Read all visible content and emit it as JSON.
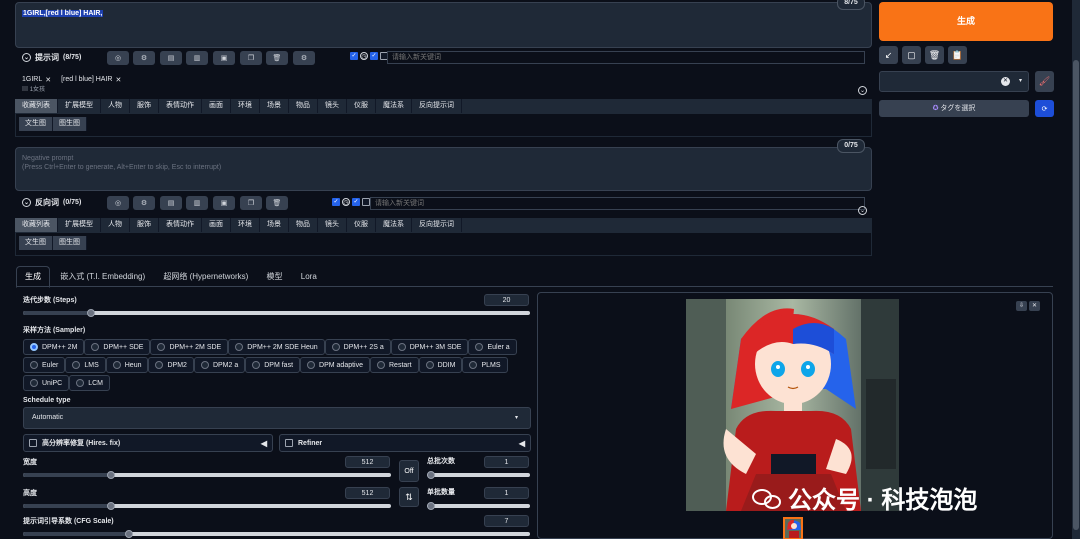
{
  "prompt": {
    "text": "1GIRL,[red l blue] HAIR,",
    "counter": "8/75",
    "label": "提示词",
    "label_count": "(8/75)",
    "search_placeholder": "请输入新关键词",
    "tags": [
      {
        "name": "1GIRL",
        "sub": "1女孩"
      },
      {
        "name": "[red l blue] HAIR",
        "sub": ""
      }
    ]
  },
  "negative": {
    "placeholder_line1": "Negative prompt",
    "placeholder_line2": "(Press Ctrl+Enter to generate, Alt+Enter to skip, Esc to interrupt)",
    "counter": "0/75",
    "label": "反向词",
    "label_count": "(0/75)",
    "search_placeholder": "请输入新关键词"
  },
  "category_tabs": [
    "收藏列表",
    "扩展模型",
    "人物",
    "服饰",
    "表情动作",
    "画面",
    "环境",
    "场景",
    "物品",
    "镜头",
    "仪服",
    "魔法系",
    "反向提示词"
  ],
  "sub_tabs": [
    "文生图",
    "图生图"
  ],
  "right": {
    "generate": "生成",
    "tag_select": "タグを選択"
  },
  "main_tabs": [
    "生成",
    "嵌入式 (T.I. Embedding)",
    "超网络 (Hypernetworks)",
    "模型",
    "Lora"
  ],
  "steps": {
    "label": "迭代步数 (Steps)",
    "value": "20"
  },
  "sampler": {
    "label": "采样方法 (Sampler)",
    "options": [
      "DPM++ 2M",
      "DPM++ SDE",
      "DPM++ 2M SDE",
      "DPM++ 2M SDE Heun",
      "DPM++ 2S a",
      "DPM++ 3M SDE",
      "Euler a",
      "Euler",
      "LMS",
      "Heun",
      "DPM2",
      "DPM2 a",
      "DPM fast",
      "DPM adaptive",
      "Restart",
      "DDIM",
      "PLMS",
      "UniPC",
      "LCM"
    ],
    "selected": "DPM++ 2M"
  },
  "schedule": {
    "label": "Schedule type",
    "value": "Automatic"
  },
  "hires": {
    "label": "高分辨率修复 (Hires. fix)"
  },
  "refiner": {
    "label": "Refiner"
  },
  "width": {
    "label": "宽度",
    "value": "512"
  },
  "height": {
    "label": "高度",
    "value": "512"
  },
  "batch_count": {
    "label": "总批次数",
    "value": "1"
  },
  "batch_size": {
    "label": "单批数量",
    "value": "1"
  },
  "cfg": {
    "label": "提示词引导系数 (CFG Scale)",
    "value": "7"
  },
  "off_label": "Off",
  "watermark": "公众号 · 科技泡泡"
}
